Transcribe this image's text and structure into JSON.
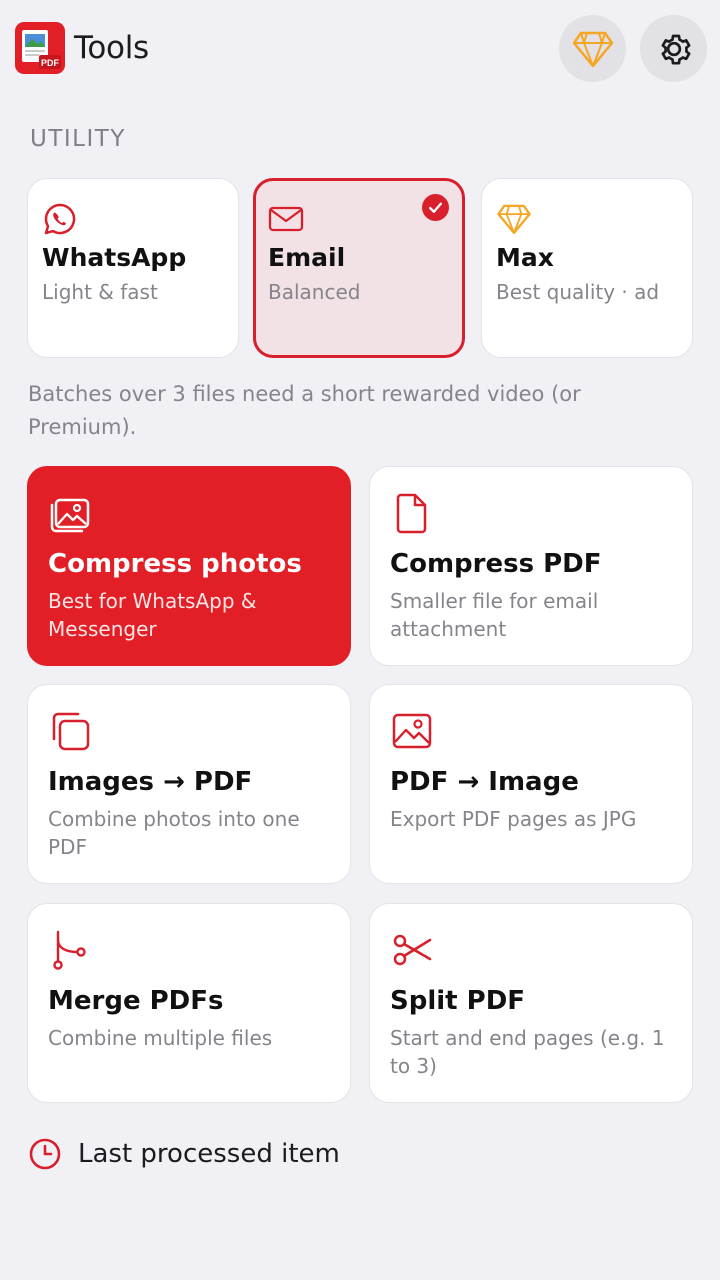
{
  "header": {
    "title": "Tools",
    "logo_icon": "pdf-app-icon",
    "premium_icon": "diamond-icon",
    "settings_icon": "gear-icon"
  },
  "section": {
    "label": "UTILITY"
  },
  "quality": {
    "selected": "Email",
    "options": [
      {
        "icon": "whatsapp-icon",
        "title": "WhatsApp",
        "subtitle": "Light & fast"
      },
      {
        "icon": "mail-icon",
        "title": "Email",
        "subtitle": "Balanced"
      },
      {
        "icon": "diamond-icon",
        "title": "Max",
        "subtitle": "Best quality · ad"
      }
    ],
    "note": "Batches over 3 files need a short rewarded video (or Premium)."
  },
  "tools": [
    {
      "icon": "photos-icon",
      "title": "Compress photos",
      "subtitle": "Best for WhatsApp & Messenger",
      "active": true
    },
    {
      "icon": "document-icon",
      "title": "Compress PDF",
      "subtitle": "Smaller file for email attachment"
    },
    {
      "icon": "stack-icon",
      "title": "Images → PDF",
      "subtitle": "Combine photos into one PDF"
    },
    {
      "icon": "image-icon",
      "title": "PDF → Image",
      "subtitle": "Export PDF pages as JPG"
    },
    {
      "icon": "merge-icon",
      "title": "Merge PDFs",
      "subtitle": "Combine multiple files"
    },
    {
      "icon": "scissors-icon",
      "title": "Split PDF",
      "subtitle": "Start and end pages (e.g. 1 to 3)"
    }
  ],
  "last_processed": {
    "icon": "clock-icon",
    "label": "Last processed item"
  },
  "colors": {
    "accent": "#e21f26",
    "selected_bg": "#f2e1e5",
    "premium": "#f5a623",
    "background": "#f1f0f5"
  }
}
